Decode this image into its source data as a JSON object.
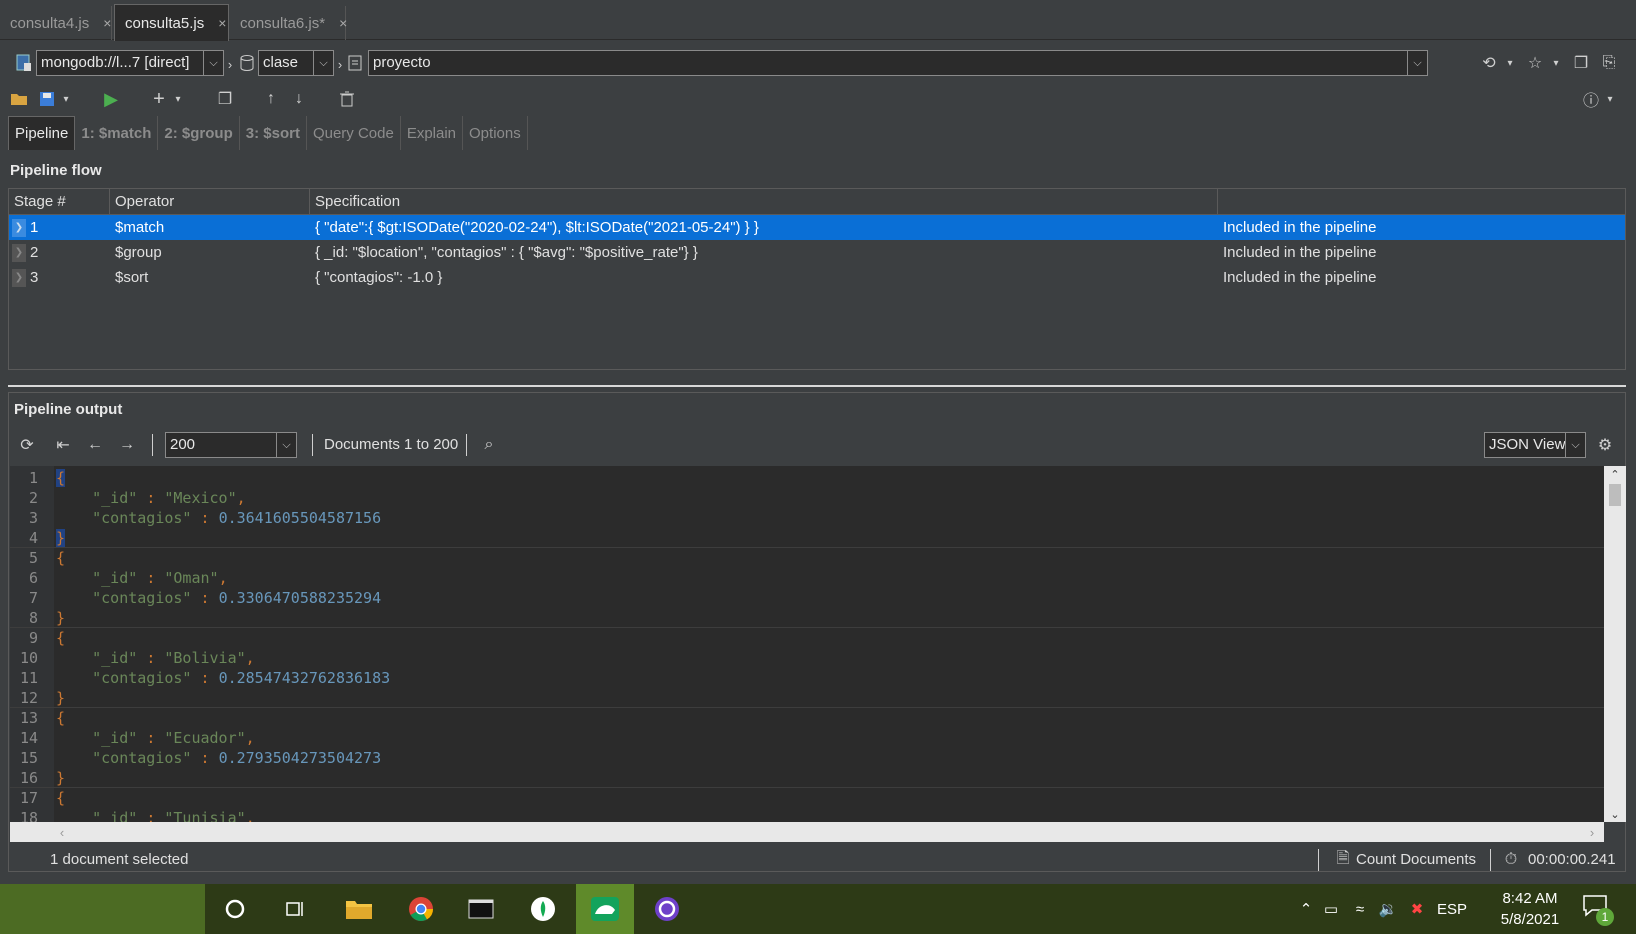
{
  "tabs": [
    {
      "label": "consulta4.js",
      "close": "×",
      "active": false
    },
    {
      "label": "consulta5.js",
      "close": "×",
      "active": true
    },
    {
      "label": "consulta6.js*",
      "close": "×",
      "active": false
    }
  ],
  "connection": {
    "server": "mongodb://l...7 [direct]",
    "database": "clase",
    "collection": "proyecto"
  },
  "subtabs": [
    {
      "label": "Pipeline",
      "active": true
    },
    {
      "label": "1: $match",
      "bold": true
    },
    {
      "label": "2: $group",
      "bold": true
    },
    {
      "label": "3: $sort",
      "bold": true
    },
    {
      "label": "Query Code"
    },
    {
      "label": "Explain"
    },
    {
      "label": "Options"
    }
  ],
  "pipeline": {
    "title": "Pipeline flow",
    "columns": [
      "Stage #",
      "Operator",
      "Specification",
      ""
    ],
    "rows": [
      {
        "stage": "1",
        "operator": "$match",
        "spec": "{ \"date\":{ $gt:ISODate(\"2020-02-24\"), $lt:ISODate(\"2021-05-24\") } }",
        "status": "Included in the pipeline",
        "selected": true
      },
      {
        "stage": "2",
        "operator": "$group",
        "spec": "{ _id: \"$location\", \"contagios\" : { \"$avg\": \"$positive_rate\"} }",
        "status": "Included in the pipeline",
        "selected": false
      },
      {
        "stage": "3",
        "operator": "$sort",
        "spec": "{ \"contagios\": -1.0 }",
        "status": "Included in the pipeline",
        "selected": false
      }
    ]
  },
  "output": {
    "title": "Pipeline output",
    "page_size": "200",
    "documents_label": "Documents 1 to 200",
    "view_mode": "JSON View",
    "documents": [
      {
        "id": "Mexico",
        "contagios": "0.3641605504587156"
      },
      {
        "id": "Oman",
        "contagios": "0.3306470588235294"
      },
      {
        "id": "Bolivia",
        "contagios": "0.28547432762836183"
      },
      {
        "id": "Ecuador",
        "contagios": "0.2793504273504273"
      },
      {
        "id": "Tunisia",
        "contagios": ""
      }
    ]
  },
  "status": {
    "selection": "1 document selected",
    "count_button": "Count Documents",
    "elapsed": "00:00:00.241"
  },
  "taskbar": {
    "language": "ESP",
    "time": "8:42 AM",
    "date": "5/8/2021",
    "notifications": "1"
  },
  "colors": {
    "selection": "#0a6fd6",
    "background": "#3c3f41",
    "editor_bg": "#2b2b2b",
    "taskbar": "#2d3a16"
  }
}
